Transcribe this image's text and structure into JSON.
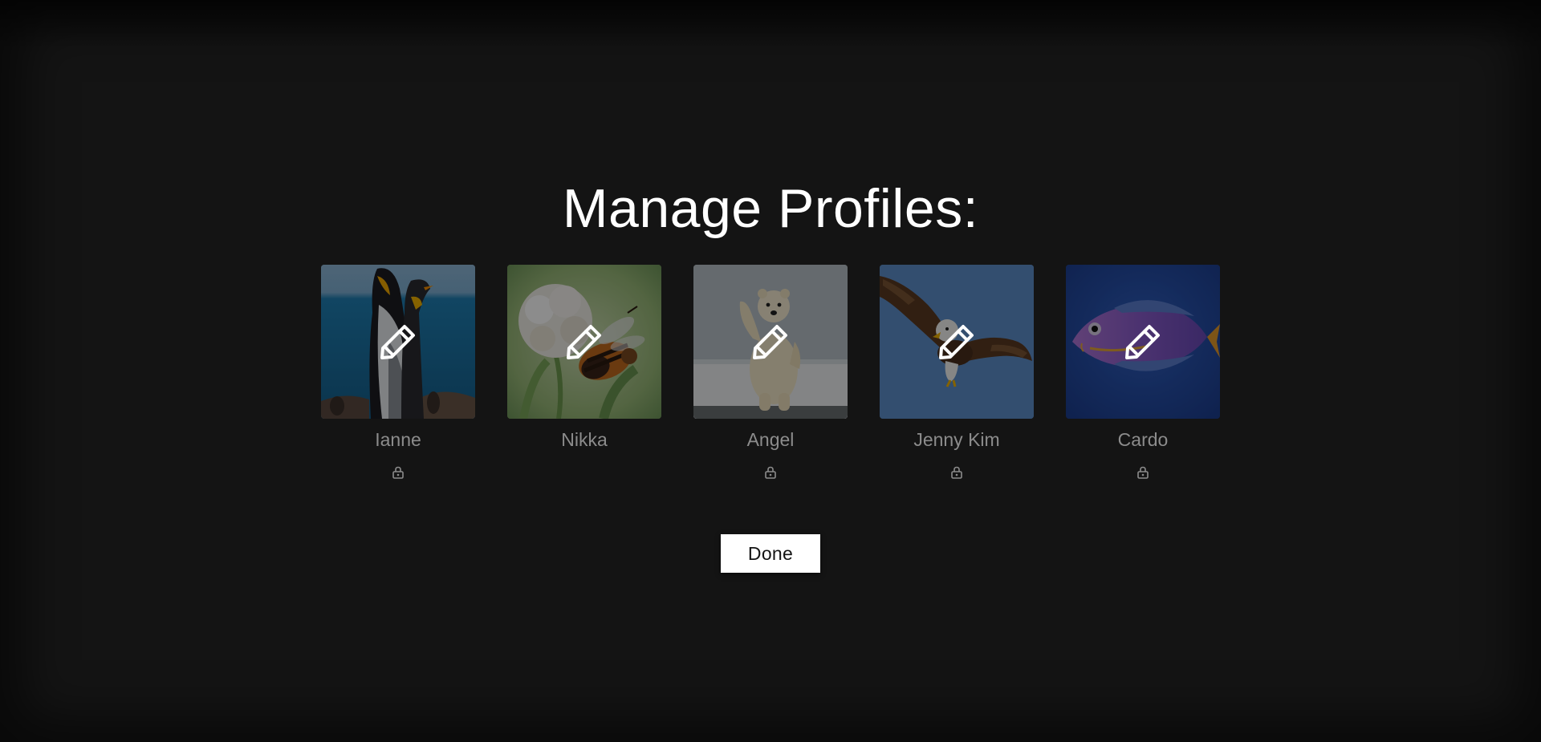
{
  "page": {
    "title": "Manage Profiles:",
    "background_color": "#141414"
  },
  "profiles": [
    {
      "name": "Ianne",
      "locked": true,
      "avatar": "penguin"
    },
    {
      "name": "Nikka",
      "locked": false,
      "avatar": "bee-on-clover"
    },
    {
      "name": "Angel",
      "locked": true,
      "avatar": "polar-bear"
    },
    {
      "name": "Jenny Kim",
      "locked": true,
      "avatar": "bald-eagle"
    },
    {
      "name": "Cardo",
      "locked": true,
      "avatar": "purple-fish"
    }
  ],
  "actions": {
    "done_label": "Done"
  },
  "icons": {
    "edit": "pencil-icon",
    "lock": "lock-icon"
  }
}
